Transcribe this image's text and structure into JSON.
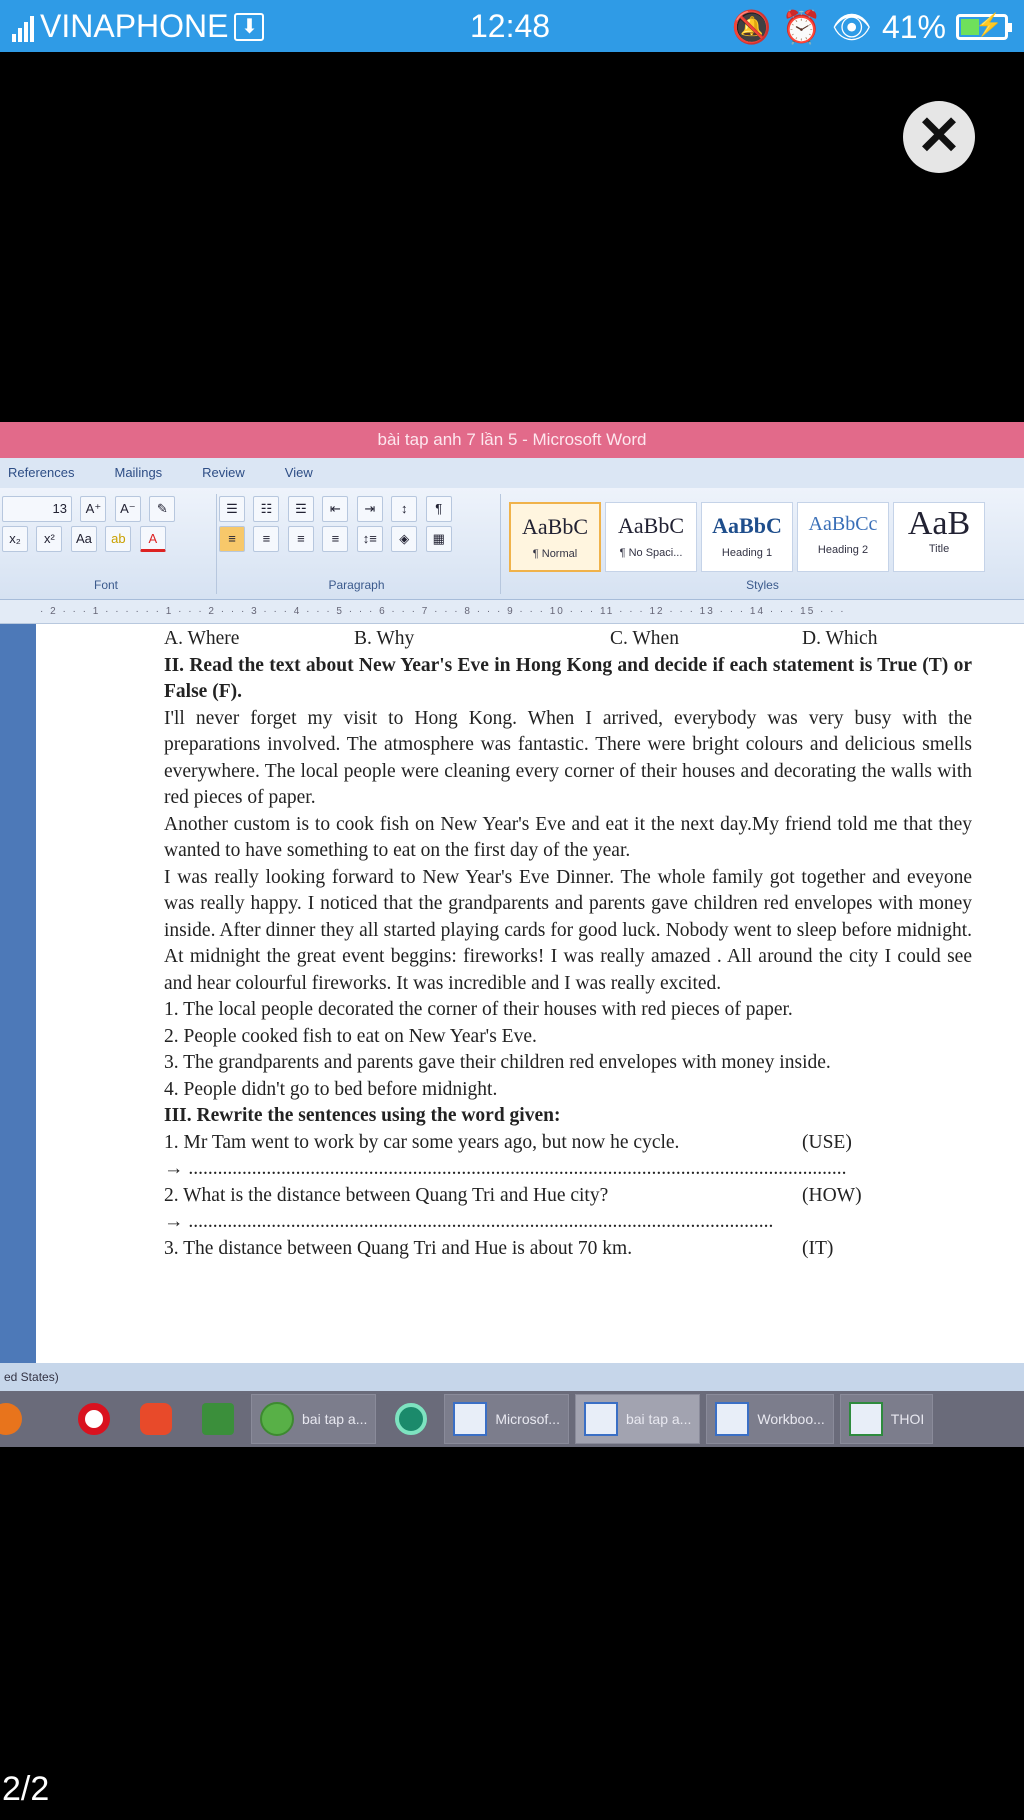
{
  "status": {
    "carrier": "VINAPHONE",
    "time": "12:48",
    "battery": "41%"
  },
  "window_title": "bài tap anh 7 lần 5 - Microsoft Word",
  "ribbon": {
    "tabs": [
      "References",
      "Mailings",
      "Review",
      "View"
    ],
    "font_size": "13",
    "groups": {
      "font": "Font",
      "paragraph": "Paragraph",
      "styles": "Styles"
    },
    "styles": [
      {
        "preview": "AaBbC",
        "name": "¶ Normal"
      },
      {
        "preview": "AaBbC",
        "name": "¶ No Spaci..."
      },
      {
        "preview": "AaBbC",
        "name": "Heading 1"
      },
      {
        "preview": "AaBbCc",
        "name": "Heading 2"
      },
      {
        "preview": "AaB",
        "name": "Title"
      }
    ]
  },
  "document": {
    "options": [
      "A. Where",
      "B. Why",
      "C. When",
      "D. Which"
    ],
    "section2_heading": "II. Read the text about New Year's Eve in Hong Kong and decide if each statement is True (T) or False (F).",
    "paragraphs": [
      "I'll never forget my visit to Hong Kong. When I arrived, everybody was very busy with the preparations involved. The atmosphere was fantastic. There were bright colours and delicious smells everywhere. The local people were cleaning every corner of their houses and decorating the walls with red pieces of paper.",
      "Another custom is to cook fish on New Year's Eve and eat it the next day.My friend told me that they wanted to have something to eat on the first day of the year.",
      "I was really looking forward to New Year's Eve Dinner. The whole family got together and eveyone was really happy. I noticed that the grandparents and parents gave children red envelopes with money inside. After dinner they all started playing cards for good luck. Nobody went to sleep before midnight. At midnight the great event beggins: fireworks! I was really amazed . All around the city I could see and hear colourful fireworks. It was incredible and I was really excited."
    ],
    "statements": [
      "1. The local people decorated the corner of their houses with red pieces of paper.",
      "2. People cooked fish to eat on New Year's Eve.",
      "3. The grandparents and parents gave their children red envelopes with money inside.",
      "4. People didn't go to bed before midnight."
    ],
    "section3_heading": "III. Rewrite the sentences using the word given:",
    "rewrites": [
      {
        "q": "1. Mr Tam went to work by car some years ago, but now he cycle.",
        "word": "(USE)",
        "answer": "→ ......................................................................................................................................."
      },
      {
        "q": "2. What is the distance between Quang Tri and Hue city?",
        "word": "(HOW)",
        "answer": "→ ........................................................................................................................"
      },
      {
        "q": "3. The distance between Quang Tri and Hue is about 70 km.",
        "word": "(IT)"
      }
    ]
  },
  "statusbar_text": "ed States)",
  "taskbar": [
    {
      "label": "bai tap a..."
    },
    {
      "label": "Microsof..."
    },
    {
      "label": "bai tap a..."
    },
    {
      "label": "Workboo..."
    },
    {
      "label": "THOI"
    }
  ],
  "page_counter": "2/2"
}
